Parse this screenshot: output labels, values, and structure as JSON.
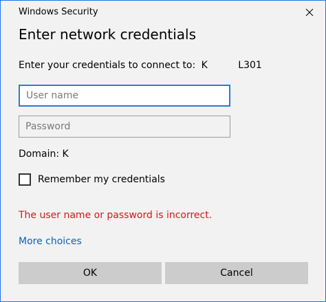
{
  "window": {
    "title": "Windows Security",
    "close_icon": "close-icon"
  },
  "dialog": {
    "heading": "Enter network credentials",
    "connect_label": "Enter your credentials to connect to:",
    "server_name": "K L301",
    "username": {
      "value": "",
      "placeholder": "User name"
    },
    "password": {
      "value": "",
      "placeholder": "Password"
    },
    "domain_text": "Domain: K",
    "remember": {
      "label": "Remember my credentials",
      "checked": false
    },
    "error_message": "The user name or password is incorrect.",
    "more_choices": "More choices",
    "ok_label": "OK",
    "cancel_label": "Cancel"
  },
  "colors": {
    "accent": "#0067c0",
    "error": "#d11919",
    "focus_border": "#2b79d8",
    "button_bg": "#cccccc",
    "dialog_bg": "#f2f2f2"
  }
}
